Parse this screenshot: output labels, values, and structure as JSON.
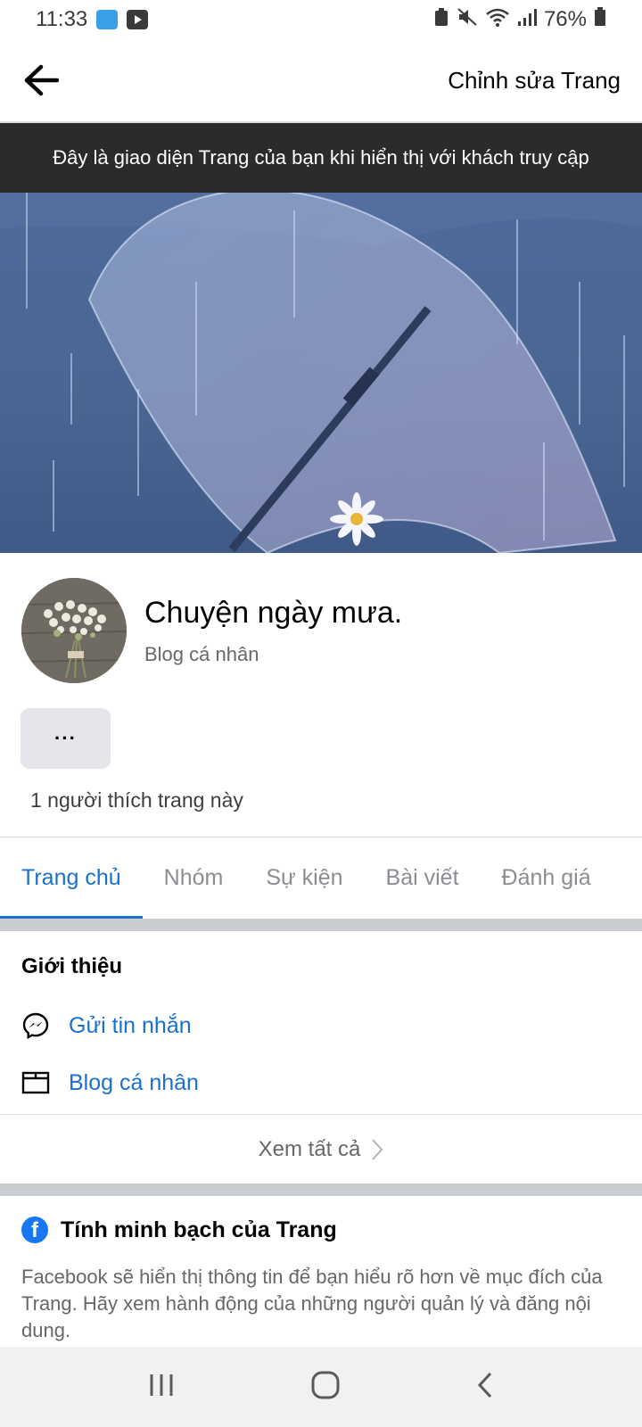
{
  "status_bar": {
    "time": "11:33",
    "battery": "76%"
  },
  "header": {
    "back_icon": "arrow-left-icon",
    "edit_label": "Chỉnh sửa Trang"
  },
  "banner": {
    "text": "Đây là giao diện Trang của bạn khi hiển thị với khách truy cập"
  },
  "profile": {
    "name": "Chuyện ngày mưa.",
    "category": "Blog cá nhân",
    "more_label": "···",
    "likes": "1 người thích trang này"
  },
  "tabs": [
    {
      "label": "Trang chủ",
      "active": true
    },
    {
      "label": "Nhóm",
      "active": false
    },
    {
      "label": "Sự kiện",
      "active": false
    },
    {
      "label": "Bài viết",
      "active": false
    },
    {
      "label": "Đánh giá",
      "active": false
    }
  ],
  "intro": {
    "title": "Giới thiệu",
    "items": [
      {
        "icon": "messenger-icon",
        "label": "Gửi tin nhắn"
      },
      {
        "icon": "category-icon",
        "label": "Blog cá nhân"
      }
    ],
    "see_all": "Xem tất cả"
  },
  "transparency": {
    "title": "Tính minh bạch của Trang",
    "body": "Facebook sẽ hiển thị thông tin để bạn hiểu rõ hơn về mục đích của Trang. Hãy xem hành động của những người quản lý và đăng nội dung."
  },
  "colors": {
    "accent": "#1b6fd0",
    "banner_bg": "#2b2b2b",
    "button_bg": "#e4e6eb"
  }
}
